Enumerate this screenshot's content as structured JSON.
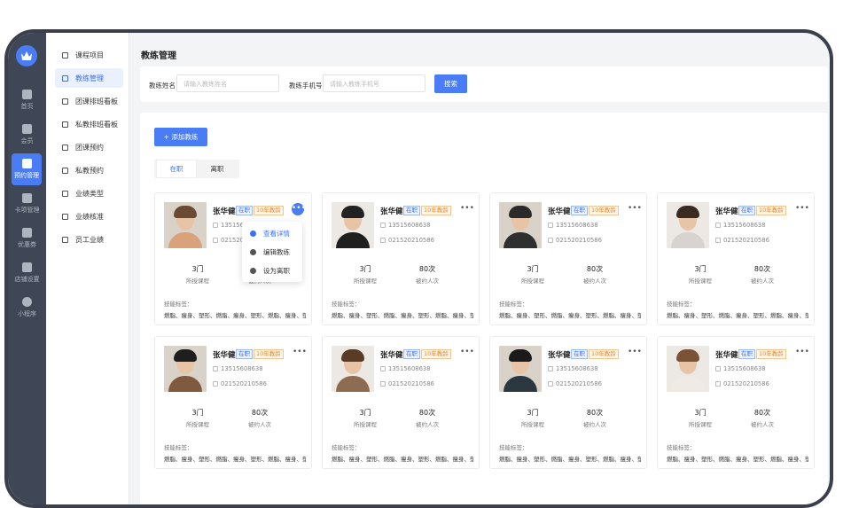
{
  "rail": {
    "items": [
      {
        "label": "首页",
        "icon": "home-icon"
      },
      {
        "label": "会员",
        "icon": "member-icon"
      },
      {
        "label": "预约管理",
        "icon": "calendar-icon"
      },
      {
        "label": "卡项管理",
        "icon": "card-icon"
      },
      {
        "label": "优惠券",
        "icon": "coupon-icon"
      },
      {
        "label": "店铺设置",
        "icon": "store-icon"
      },
      {
        "label": "小程序",
        "icon": "miniapp-icon"
      }
    ]
  },
  "subnav": {
    "items": [
      {
        "label": "课程项目"
      },
      {
        "label": "教练管理"
      },
      {
        "label": "团课排班看板"
      },
      {
        "label": "私教排班看板"
      },
      {
        "label": "团课预约"
      },
      {
        "label": "私教预约"
      },
      {
        "label": "业绩类型"
      },
      {
        "label": "业绩核准"
      },
      {
        "label": "员工业绩"
      }
    ]
  },
  "page": {
    "title": "教练管理"
  },
  "search": {
    "name_label": "教练姓名",
    "name_placeholder": "请输入教练姓名",
    "phone_label": "教练手机号",
    "phone_placeholder": "请输入教练手机号",
    "button": "搜索"
  },
  "add_button": "+ 添加教练",
  "tabs": [
    "在职",
    "离职"
  ],
  "menu": [
    "查看详情",
    "编辑教练",
    "设为离职"
  ],
  "card": {
    "name": "张华健",
    "status": "在职",
    "years": "10年教龄",
    "phone_row1": "13515608638",
    "phone_row1_short": "1351560",
    "tel_row1": "021520210586",
    "tel_row1_short": "0215202",
    "courses": "3门",
    "courses_label": "所授课程",
    "bookings": "80次",
    "bookings_label": "被约人次",
    "skill_title": "技能标签：",
    "skills": "燃脂、瘦身、塑形、燃脂、瘦身、塑形、燃脂、瘦身、塑形..."
  },
  "colors": {
    "accent": "#4a7cf6",
    "rail": "#3f4656",
    "tag_orange": "#e0882a"
  }
}
